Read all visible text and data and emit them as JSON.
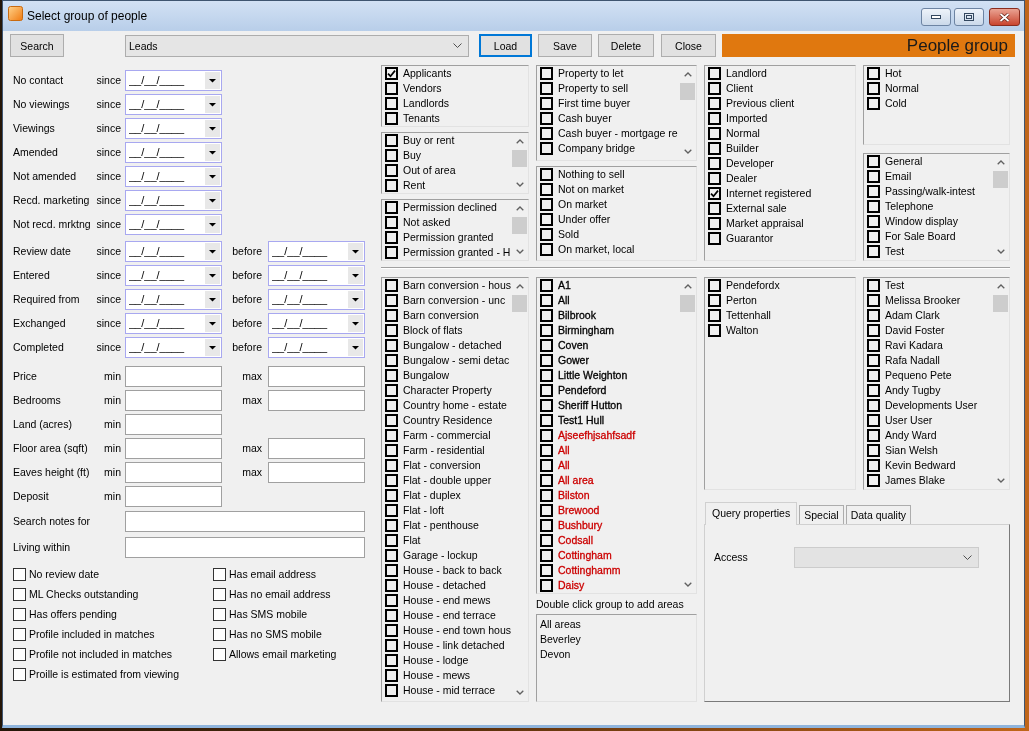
{
  "window": {
    "title": "Select group of people"
  },
  "toolbar": {
    "search_button": "Search",
    "group": {
      "value": "Leads"
    },
    "buttons": [
      {
        "label": "Load",
        "focused": true
      },
      {
        "label": "Save",
        "focused": false
      },
      {
        "label": "Delete",
        "focused": false
      },
      {
        "label": "Close",
        "focused": false
      }
    ],
    "banner": "People group"
  },
  "date_filters": [
    {
      "label": "No contact",
      "since": {
        "label": "since",
        "placeholder": "__/__/____"
      }
    },
    {
      "label": "No viewings",
      "since": {
        "label": "since",
        "placeholder": "__/__/____"
      }
    },
    {
      "label": "Viewings",
      "since": {
        "label": "since",
        "placeholder": "__/__/____"
      }
    },
    {
      "label": "Amended",
      "since": {
        "label": "since",
        "placeholder": "__/__/____"
      }
    },
    {
      "label": "Not amended",
      "since": {
        "label": "since",
        "placeholder": "__/__/____"
      }
    },
    {
      "label": "Recd. marketing",
      "since": {
        "label": "since",
        "placeholder": "__/__/____"
      }
    },
    {
      "label": "Not recd. mrktng",
      "since": {
        "label": "since",
        "placeholder": "__/__/____"
      }
    },
    {
      "label": "Review date",
      "since": {
        "label": "since",
        "placeholder": "__/__/____"
      },
      "before": {
        "label": "before",
        "placeholder": "__/__/____"
      }
    },
    {
      "label": "Entered",
      "since": {
        "label": "since",
        "placeholder": "__/__/____"
      },
      "before": {
        "label": "before",
        "placeholder": "__/__/____"
      }
    },
    {
      "label": "Required from",
      "since": {
        "label": "since",
        "placeholder": "__/__/____"
      },
      "before": {
        "label": "before",
        "placeholder": "__/__/____"
      }
    },
    {
      "label": "Exchanged",
      "since": {
        "label": "since",
        "placeholder": "__/__/____"
      },
      "before": {
        "label": "before",
        "placeholder": "__/__/____"
      }
    },
    {
      "label": "Completed",
      "since": {
        "label": "since",
        "placeholder": "__/__/____"
      },
      "before": {
        "label": "before",
        "placeholder": "__/__/____"
      }
    }
  ],
  "range_filters": [
    {
      "label": "Price",
      "min": {
        "label": "min"
      },
      "max": {
        "label": "max"
      }
    },
    {
      "label": "Bedrooms",
      "min": {
        "label": "min"
      },
      "max": {
        "label": "max"
      }
    },
    {
      "label": "Land (acres)",
      "min": {
        "label": "min"
      }
    },
    {
      "label": "Floor area (sqft)",
      "min": {
        "label": "min"
      },
      "max": {
        "label": "max"
      }
    },
    {
      "label": "Eaves height (ft)",
      "min": {
        "label": "min"
      },
      "max": {
        "label": "max"
      }
    },
    {
      "label": "Deposit",
      "min": {
        "label": "min"
      }
    }
  ],
  "text_filters": [
    {
      "label": "Search notes for"
    },
    {
      "label": "Living within"
    }
  ],
  "options": {
    "column_1": [
      {
        "label": "No review date",
        "checked": false
      },
      {
        "label": "ML Checks outstanding",
        "checked": false
      },
      {
        "label": "Has offers pending",
        "checked": false
      },
      {
        "label": "Profile included in matches",
        "checked": false
      },
      {
        "label": "Profile not included in matches",
        "checked": false
      },
      {
        "label": "Proille is estimated from viewing",
        "checked": false
      }
    ],
    "column_2": [
      {
        "label": "Has email address",
        "checked": false
      },
      {
        "label": "Has no email address",
        "checked": false
      },
      {
        "label": "Has SMS mobile",
        "checked": false
      },
      {
        "label": "Has no SMS mobile",
        "checked": false
      },
      {
        "label": "Allows email marketing",
        "checked": false
      }
    ]
  },
  "upper_panel": {
    "columns": [
      {
        "lists": [
          {
            "scrollbar": false,
            "items": [
              {
                "label": "Applicants",
                "checked": true
              },
              {
                "label": "Vendors",
                "checked": false
              },
              {
                "label": "Landlords",
                "checked": false
              },
              {
                "label": "Tenants",
                "checked": false
              }
            ]
          },
          {
            "scrollbar": true,
            "items": [
              {
                "label": "Buy or rent",
                "checked": false
              },
              {
                "label": "Buy",
                "checked": false
              },
              {
                "label": "Out of area",
                "checked": false
              },
              {
                "label": "Rent",
                "checked": false
              }
            ]
          },
          {
            "scrollbar": true,
            "items": [
              {
                "label": "Permission declined",
                "checked": false
              },
              {
                "label": "Not asked",
                "checked": false
              },
              {
                "label": "Permission granted",
                "checked": false
              },
              {
                "label": "Permission granted - H",
                "checked": false
              }
            ]
          }
        ]
      },
      {
        "lists": [
          {
            "scrollbar": true,
            "items": [
              {
                "label": "Property to let",
                "checked": false
              },
              {
                "label": "Property to sell",
                "checked": false
              },
              {
                "label": "First time buyer",
                "checked": false
              },
              {
                "label": "Cash buyer",
                "checked": false
              },
              {
                "label": "Cash buyer - mortgage re",
                "checked": false
              },
              {
                "label": "Company bridge",
                "checked": false
              }
            ]
          },
          {
            "scrollbar": false,
            "items": [
              {
                "label": "Nothing to sell",
                "checked": false
              },
              {
                "label": "Not on market",
                "checked": false
              },
              {
                "label": "On market",
                "checked": false
              },
              {
                "label": "Under offer",
                "checked": false
              },
              {
                "label": "Sold",
                "checked": false
              },
              {
                "label": "On market, local",
                "checked": false
              }
            ]
          }
        ]
      },
      {
        "lists": [
          {
            "scrollbar": false,
            "items": [
              {
                "label": "Landlord",
                "checked": false
              },
              {
                "label": "Client",
                "checked": false
              },
              {
                "label": "Previous client",
                "checked": false
              },
              {
                "label": "Imported",
                "checked": false
              },
              {
                "label": "Normal",
                "checked": false
              },
              {
                "label": "Builder",
                "checked": false
              },
              {
                "label": "Developer",
                "checked": false
              },
              {
                "label": "Dealer",
                "checked": false
              },
              {
                "label": "Internet registered",
                "checked": true
              },
              {
                "label": "External sale",
                "checked": false
              },
              {
                "label": "Market appraisal",
                "checked": false
              },
              {
                "label": "Guarantor",
                "checked": false
              }
            ]
          }
        ]
      },
      {
        "lists": [
          {
            "scrollbar": false,
            "items": [
              {
                "label": "Hot",
                "checked": false
              },
              {
                "label": "Normal",
                "checked": false
              },
              {
                "label": "Cold",
                "checked": false
              }
            ]
          },
          {
            "scrollbar": true,
            "items": [
              {
                "label": "General",
                "checked": false
              },
              {
                "label": "Email",
                "checked": false
              },
              {
                "label": "Passing/walk-intest",
                "checked": false
              },
              {
                "label": "Telephone",
                "checked": false
              },
              {
                "label": "Window display",
                "checked": false
              },
              {
                "label": "For Sale Board",
                "checked": false
              },
              {
                "label": "Test",
                "checked": false
              }
            ]
          }
        ]
      }
    ]
  },
  "lower_panel": {
    "list_1": {
      "scrollbar": true,
      "items": [
        {
          "label": "Barn conversion - hous",
          "checked": false
        },
        {
          "label": "Barn conversion - unc",
          "checked": false
        },
        {
          "label": "Barn conversion",
          "checked": false
        },
        {
          "label": "Block of flats",
          "checked": false
        },
        {
          "label": "Bungalow - detached",
          "checked": false
        },
        {
          "label": "Bungalow - semi detac",
          "checked": false
        },
        {
          "label": "Bungalow",
          "checked": false
        },
        {
          "label": "Character Property",
          "checked": false
        },
        {
          "label": "Country home - estate",
          "checked": false
        },
        {
          "label": "Country Residence",
          "checked": false
        },
        {
          "label": "Farm - commercial",
          "checked": false
        },
        {
          "label": "Farm - residential",
          "checked": false
        },
        {
          "label": "Flat - conversion",
          "checked": false
        },
        {
          "label": "Flat - double upper",
          "checked": false
        },
        {
          "label": "Flat - duplex",
          "checked": false
        },
        {
          "label": "Flat - loft",
          "checked": false
        },
        {
          "label": "Flat - penthouse",
          "checked": false
        },
        {
          "label": "Flat",
          "checked": false
        },
        {
          "label": "Garage - lockup",
          "checked": false
        },
        {
          "label": "House - back to back",
          "checked": false
        },
        {
          "label": "House - detached",
          "checked": false
        },
        {
          "label": "House - end mews",
          "checked": false
        },
        {
          "label": "House - end terrace",
          "checked": false
        },
        {
          "label": "House - end town hous",
          "checked": false
        },
        {
          "label": "House - link detached",
          "checked": false
        },
        {
          "label": "House - lodge",
          "checked": false
        },
        {
          "label": "House - mews",
          "checked": false
        },
        {
          "label": "House - mid terrace",
          "checked": false
        }
      ]
    },
    "list_2": {
      "scrollbar": true,
      "items": [
        {
          "label": "A1",
          "checked": false,
          "color": "#000000"
        },
        {
          "label": "All",
          "checked": false,
          "color": "#000000"
        },
        {
          "label": "Bilbrook",
          "checked": false,
          "color": "#000000"
        },
        {
          "label": "Birmingham",
          "checked": false,
          "color": "#000000"
        },
        {
          "label": "Coven",
          "checked": false,
          "color": "#000000"
        },
        {
          "label": "Gower",
          "checked": false,
          "color": "#000000"
        },
        {
          "label": "Little Weighton",
          "checked": false,
          "color": "#000000"
        },
        {
          "label": "Pendeford",
          "checked": false,
          "color": "#000000"
        },
        {
          "label": "Sheriff Hutton",
          "checked": false,
          "color": "#000000"
        },
        {
          "label": "Test1 Hull",
          "checked": false,
          "color": "#000000"
        },
        {
          "label": "Ajseefhjsahfsadf",
          "checked": false,
          "color": "#cc0000"
        },
        {
          "label": "All",
          "checked": false,
          "color": "#cc0000"
        },
        {
          "label": "All",
          "checked": false,
          "color": "#cc0000"
        },
        {
          "label": "All area",
          "checked": false,
          "color": "#cc0000"
        },
        {
          "label": "Bilston",
          "checked": false,
          "color": "#cc0000"
        },
        {
          "label": "Brewood",
          "checked": false,
          "color": "#cc0000"
        },
        {
          "label": "Bushbury",
          "checked": false,
          "color": "#cc0000"
        },
        {
          "label": "Codsall",
          "checked": false,
          "color": "#cc0000"
        },
        {
          "label": "Cottingham",
          "checked": false,
          "color": "#cc0000"
        },
        {
          "label": "Cottinghamm",
          "checked": false,
          "color": "#cc0000"
        },
        {
          "label": "Daisy",
          "checked": false,
          "color": "#cc0000"
        }
      ]
    },
    "area_groups": {
      "label": "Double click group to add areas",
      "items": [
        "All areas",
        "Beverley",
        "Devon"
      ]
    },
    "list_3": {
      "scrollbar": false,
      "items": [
        {
          "label": "Pendefordx",
          "checked": false
        },
        {
          "label": "Perton",
          "checked": false
        },
        {
          "label": "Tettenhall",
          "checked": false
        },
        {
          "label": "Walton",
          "checked": false
        }
      ]
    },
    "list_4": {
      "scrollbar": true,
      "items": [
        {
          "label": "Test",
          "checked": false
        },
        {
          "label": "Melissa Brooker",
          "checked": false
        },
        {
          "label": "Adam Clark",
          "checked": false
        },
        {
          "label": "David Foster",
          "checked": false
        },
        {
          "label": "Ravi Kadara",
          "checked": false
        },
        {
          "label": "Rafa Nadall",
          "checked": false
        },
        {
          "label": "Pequeno Pete",
          "checked": false
        },
        {
          "label": "Andy Tugby",
          "checked": false
        },
        {
          "label": "Developments User",
          "checked": false
        },
        {
          "label": "User User",
          "checked": false
        },
        {
          "label": "Andy Ward",
          "checked": false
        },
        {
          "label": "Sian Welsh",
          "checked": false
        },
        {
          "label": "Kevin Bedward",
          "checked": false
        },
        {
          "label": "James Blake",
          "checked": false
        }
      ]
    }
  },
  "tabs": [
    {
      "label": "Query properties",
      "selected": true
    },
    {
      "label": "Special",
      "selected": false
    },
    {
      "label": "Data quality",
      "selected": false
    }
  ],
  "tab_panel": {
    "access": {
      "label": "Access",
      "disabled": true
    }
  }
}
